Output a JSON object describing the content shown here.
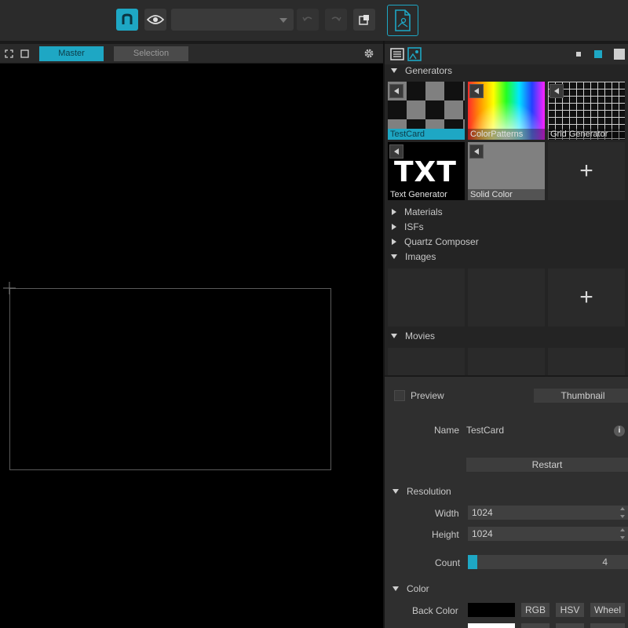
{
  "toolbar": {
    "preset_dropdown_value": "",
    "icons": [
      "app-logo-icon",
      "eye-icon",
      "undo-icon",
      "redo-icon",
      "export-icon",
      "document-icon"
    ]
  },
  "viewport": {
    "tabs": [
      {
        "label": "Master",
        "active": true
      },
      {
        "label": "Selection",
        "active": false
      }
    ],
    "icons": [
      "fullscreen-icon",
      "frame-icon",
      "gear-icon"
    ]
  },
  "library": {
    "header_icons": [
      "list-view-icon",
      "image-view-icon"
    ],
    "generators": {
      "label": "Generators",
      "items": [
        {
          "label": "TestCard",
          "selected": true
        },
        {
          "label": "ColorPatterns",
          "selected": false
        },
        {
          "label": "Grid Generator",
          "selected": false
        },
        {
          "label": "Text Generator",
          "selected": false,
          "preview_text": "TXT"
        },
        {
          "label": "Solid Color",
          "selected": false
        }
      ],
      "add_label": "+"
    },
    "materials": {
      "label": "Materials"
    },
    "isfs": {
      "label": "ISFs"
    },
    "quartz": {
      "label": "Quartz Composer"
    },
    "images": {
      "label": "Images",
      "add_label": "+"
    },
    "movies": {
      "label": "Movies"
    }
  },
  "inspector": {
    "preview": {
      "label": "Preview",
      "checked": false,
      "mode": "Thumbnail"
    },
    "name": {
      "label": "Name",
      "value": "TestCard",
      "info_icon": "i"
    },
    "restart_label": "Restart",
    "resolution": {
      "label": "Resolution",
      "width_label": "Width",
      "width_value": "1024",
      "height_label": "Height",
      "height_value": "1024"
    },
    "count": {
      "label": "Count",
      "value": "4",
      "fill_fraction": 0.06
    },
    "color": {
      "label": "Color",
      "back_color_label": "Back Color",
      "back_color": "#000000",
      "second_color": "#ffffff",
      "mode_buttons": [
        "RGB",
        "HSV",
        "Wheel"
      ]
    }
  },
  "colors": {
    "accent": "#1ea7c4",
    "toolbar_bg": "#2b2b2b",
    "panel_bg": "#242424",
    "inspector_bg": "#2f2f2f",
    "viewport_bg": "#000000"
  }
}
